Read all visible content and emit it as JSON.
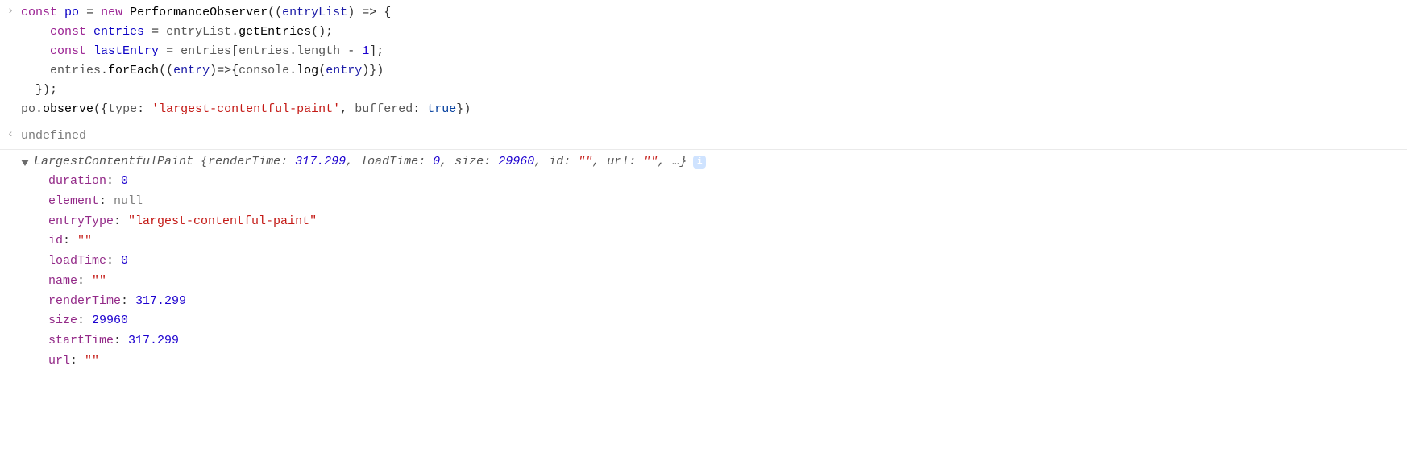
{
  "prompt_in": "›",
  "prompt_out": "‹",
  "undefined_text": "undefined",
  "code": {
    "const": "const",
    "new": "new",
    "po": "po",
    "PerformanceObserver": "PerformanceObserver",
    "entryList": "entryList",
    "arrow": "=>",
    "entries": "entries",
    "getEntries": "getEntries",
    "lastEntry": "lastEntry",
    "length": "length",
    "minus1": "1",
    "forEach": "forEach",
    "entry": "entry",
    "console": "console",
    "log": "log",
    "observe": "observe",
    "type_key": "type",
    "type_val": "'largest-contentful-paint'",
    "buffered_key": "buffered",
    "true_val": "true"
  },
  "object": {
    "className": "LargestContentfulPaint",
    "info_glyph": "i",
    "summary": [
      {
        "key": "renderTime",
        "value": "317.299",
        "kind": "num"
      },
      {
        "key": "loadTime",
        "value": "0",
        "kind": "num"
      },
      {
        "key": "size",
        "value": "29960",
        "kind": "num"
      },
      {
        "key": "id",
        "value": "\"\"",
        "kind": "str"
      },
      {
        "key": "url",
        "value": "\"\"",
        "kind": "str"
      }
    ],
    "ellipsis": "…",
    "props": [
      {
        "key": "duration",
        "value": "0",
        "kind": "num"
      },
      {
        "key": "element",
        "value": "null",
        "kind": "null"
      },
      {
        "key": "entryType",
        "value": "\"largest-contentful-paint\"",
        "kind": "str"
      },
      {
        "key": "id",
        "value": "\"\"",
        "kind": "str"
      },
      {
        "key": "loadTime",
        "value": "0",
        "kind": "num"
      },
      {
        "key": "name",
        "value": "\"\"",
        "kind": "str"
      },
      {
        "key": "renderTime",
        "value": "317.299",
        "kind": "num"
      },
      {
        "key": "size",
        "value": "29960",
        "kind": "num"
      },
      {
        "key": "startTime",
        "value": "317.299",
        "kind": "num"
      },
      {
        "key": "url",
        "value": "\"\"",
        "kind": "str"
      }
    ]
  }
}
